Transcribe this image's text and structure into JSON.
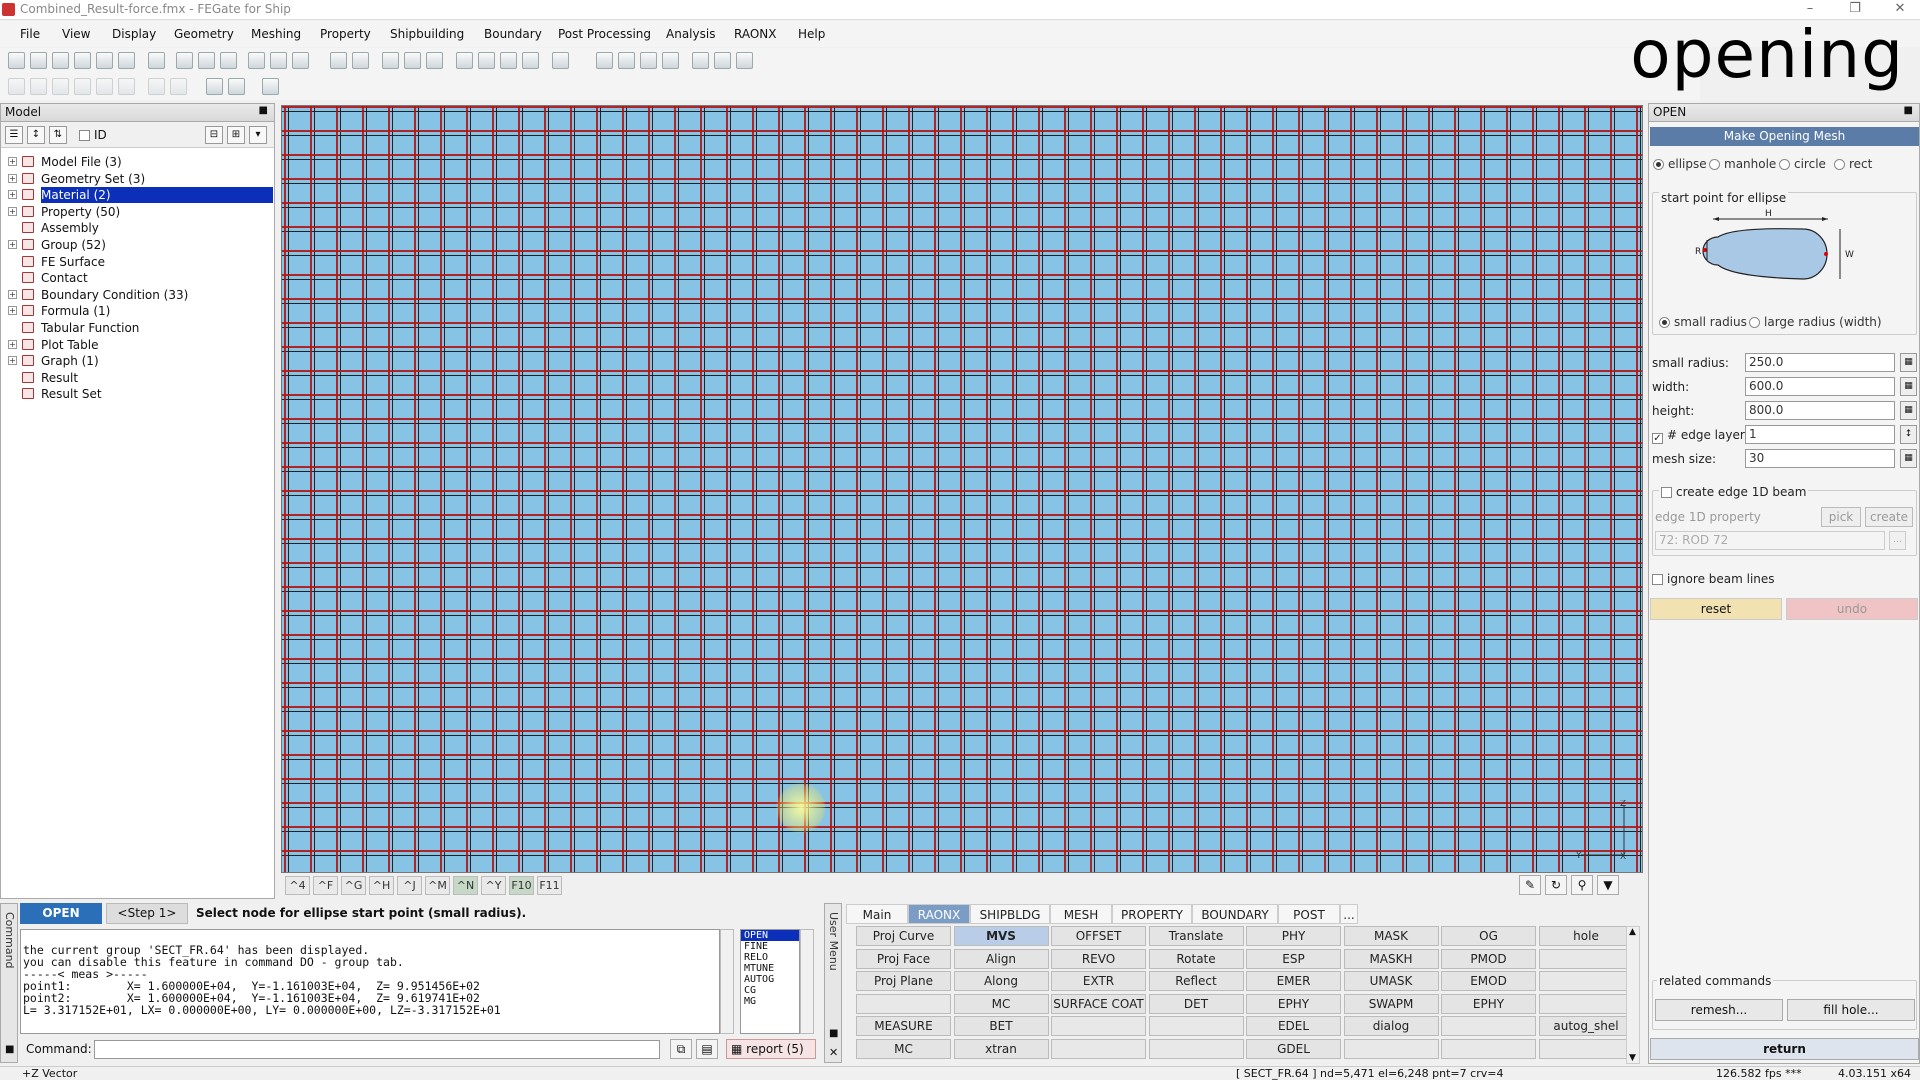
{
  "app": {
    "title": "Combined_Result-force.fmx - FEGate for Ship",
    "overlay_word": "opening"
  },
  "menu": [
    "File",
    "View",
    "Display",
    "Geometry",
    "Meshing",
    "Property",
    "Shipbuilding",
    "Boundary",
    "Post Processing",
    "Analysis",
    "RAONX",
    "Help"
  ],
  "model_panel": {
    "title": "Model",
    "id_label": "ID",
    "tree": [
      {
        "label": "Model File (3)",
        "expandable": true,
        "selected": false
      },
      {
        "label": "Geometry Set (3)",
        "expandable": true,
        "selected": false
      },
      {
        "label": "Material (2)",
        "expandable": true,
        "selected": true
      },
      {
        "label": "Property (50)",
        "expandable": true,
        "selected": false
      },
      {
        "label": "Assembly",
        "expandable": false,
        "selected": false
      },
      {
        "label": "Group (52)",
        "expandable": true,
        "selected": false
      },
      {
        "label": "FE Surface",
        "expandable": false,
        "selected": false
      },
      {
        "label": "Contact",
        "expandable": false,
        "selected": false
      },
      {
        "label": "Boundary Condition (33)",
        "expandable": true,
        "selected": false
      },
      {
        "label": "Formula (1)",
        "expandable": true,
        "selected": false
      },
      {
        "label": "Tabular Function",
        "expandable": false,
        "selected": false
      },
      {
        "label": "Plot Table",
        "expandable": true,
        "selected": false
      },
      {
        "label": "Graph (1)",
        "expandable": true,
        "selected": false
      },
      {
        "label": "Result",
        "expandable": false,
        "selected": false
      },
      {
        "label": "Result Set",
        "expandable": false,
        "selected": false
      }
    ]
  },
  "view_keys": [
    "^4",
    "^F",
    "^G",
    "^H",
    "^J",
    "^M",
    "^N",
    "^Y",
    "F10",
    "F11"
  ],
  "open_panel": {
    "title": "OPEN",
    "header": "Make Opening Mesh",
    "shape_options": [
      "ellipse",
      "manhole",
      "circle",
      "rect"
    ],
    "group_label": "start point for ellipse",
    "diagram_labels": {
      "h": "H",
      "w": "W",
      "r": "R"
    },
    "radius_options": [
      "small radius",
      "large radius (width)"
    ],
    "fields": [
      {
        "label": "small radius:",
        "value": "250.0"
      },
      {
        "label": "width:",
        "value": "600.0"
      },
      {
        "label": "height:",
        "value": "800.0"
      },
      {
        "label": "# edge layers:",
        "value": "1",
        "checkbox": true
      },
      {
        "label": "mesh size:",
        "value": "30"
      }
    ],
    "create_edge_label": "create edge 1D beam",
    "edge_prop_label": "edge 1D property",
    "pick_label": "pick",
    "create_label": "create",
    "edge_prop_value": "72: ROD 72",
    "ignore_label": "ignore beam lines",
    "reset_label": "reset",
    "undo_label": "undo",
    "related_label": "related commands",
    "remesh_label": "remesh...",
    "fillhole_label": "fill hole...",
    "return_label": "return"
  },
  "command": {
    "side_label": "Command",
    "mode": "OPEN",
    "step": "<Step 1>",
    "prompt": "Select node for ellipse start point (small radius).",
    "console_lines": [
      "the current group 'SECT_FR.64' has been displayed.",
      "you can disable this feature in command DO - group tab.",
      "-----< meas >-----",
      "point1:        X= 1.600000E+04,  Y=-1.161003E+04,  Z= 9.951456E+02",
      "point2:        X= 1.600000E+04,  Y=-1.161003E+04,  Z= 9.619741E+02",
      "L= 3.317152E+01, LX= 0.000000E+00, LY= 0.000000E+00, LZ=-3.317152E+01"
    ],
    "list": [
      "OPEN",
      "FINE",
      "RELO",
      "MTUNE",
      "AUTOG",
      "CG",
      "MG"
    ],
    "command_label": "Command:",
    "report_label": "report (5)"
  },
  "user_menu": {
    "side_label": "User Menu",
    "tabs": [
      "Main",
      "RAONX",
      "SHIPBLDG",
      "MESH",
      "PROPERTY",
      "BOUNDARY",
      "POST",
      "..."
    ],
    "active_tab": 1,
    "grid": [
      [
        "Proj Curve",
        "MVS",
        "OFFSET",
        "Translate",
        "PHY",
        "MASK",
        "OG",
        "hole"
      ],
      [
        "Proj Face",
        "Align",
        "REVO",
        "Rotate",
        "ESP",
        "MASKH",
        "PMOD",
        ""
      ],
      [
        "Proj Plane",
        "Along",
        "EXTR",
        "Reflect",
        "EMER",
        "UMASK",
        "EMOD",
        ""
      ],
      [
        "",
        "MC",
        "SURFACE COAT",
        "DET",
        "EPHY",
        "SWAPM",
        "EPHY",
        ""
      ],
      [
        "MEASURE",
        "BET",
        "",
        "",
        "EDEL",
        "dialog",
        "",
        "autog_shel"
      ],
      [
        "MC",
        "xtran",
        "",
        "",
        "GDEL",
        "",
        "",
        ""
      ]
    ]
  },
  "status": {
    "left": "+Z Vector",
    "mid": "[ SECT_FR.64 ]  nd=5,471  el=6,248  pnt=7  crv=4",
    "fps": "126.582 fps ***",
    "version": "4.03.151 x64"
  },
  "colors": {
    "mesh_fill": "#87c3e4",
    "mesh_line": "#b41414",
    "selection": "#0b2fb9",
    "accent": "#5b7ca7",
    "reset_btn": "#f2e2b2",
    "undo_btn": "#f0c4c4"
  }
}
